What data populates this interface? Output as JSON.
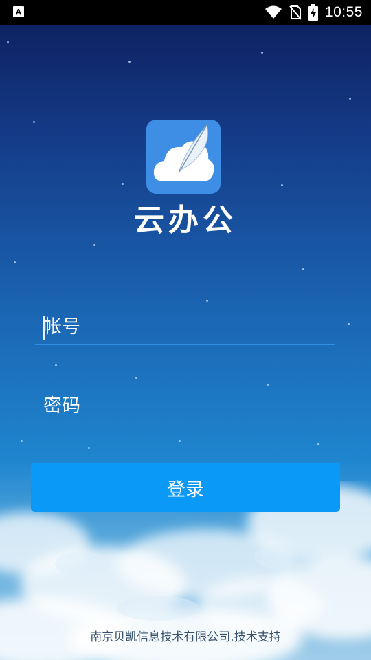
{
  "status_bar": {
    "time": "10:55",
    "icons": [
      "a-notification-icon",
      "wifi-icon",
      "no-sim-icon",
      "battery-charging-icon"
    ],
    "background": "#000000"
  },
  "app": {
    "name": "云办公",
    "logo_icon": "cloud-feather-icon",
    "logo_color": "#3f8ee6"
  },
  "form": {
    "account_placeholder": "帐号",
    "password_placeholder": "密码",
    "login_label": "登录",
    "accent_color": "#0a99f7"
  },
  "footer": {
    "text": "南京贝凯信息技术有限公司.技术支持"
  }
}
